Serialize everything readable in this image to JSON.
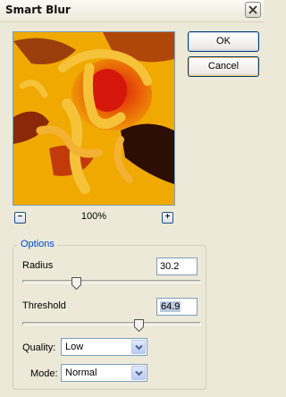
{
  "window": {
    "title": "Smart Blur"
  },
  "buttons": {
    "ok": "OK",
    "cancel": "Cancel"
  },
  "zoom": {
    "level": "100%",
    "minus": "−",
    "plus": "+"
  },
  "options": {
    "legend": "Options",
    "radius": {
      "label": "Radius",
      "value": "30.2",
      "slider_fraction": 0.3
    },
    "threshold": {
      "label": "Threshold",
      "value": "64.9",
      "slider_fraction": 0.65
    },
    "quality": {
      "label": "Quality:",
      "value": "Low"
    },
    "mode": {
      "label": "Mode:",
      "value": "Normal"
    }
  },
  "icons": {
    "close": "close-icon",
    "zoom_out": "minus-icon",
    "zoom_in": "plus-icon",
    "dropdown": "chevron-down-icon",
    "slider_thumb": "slider-thumb-icon"
  }
}
